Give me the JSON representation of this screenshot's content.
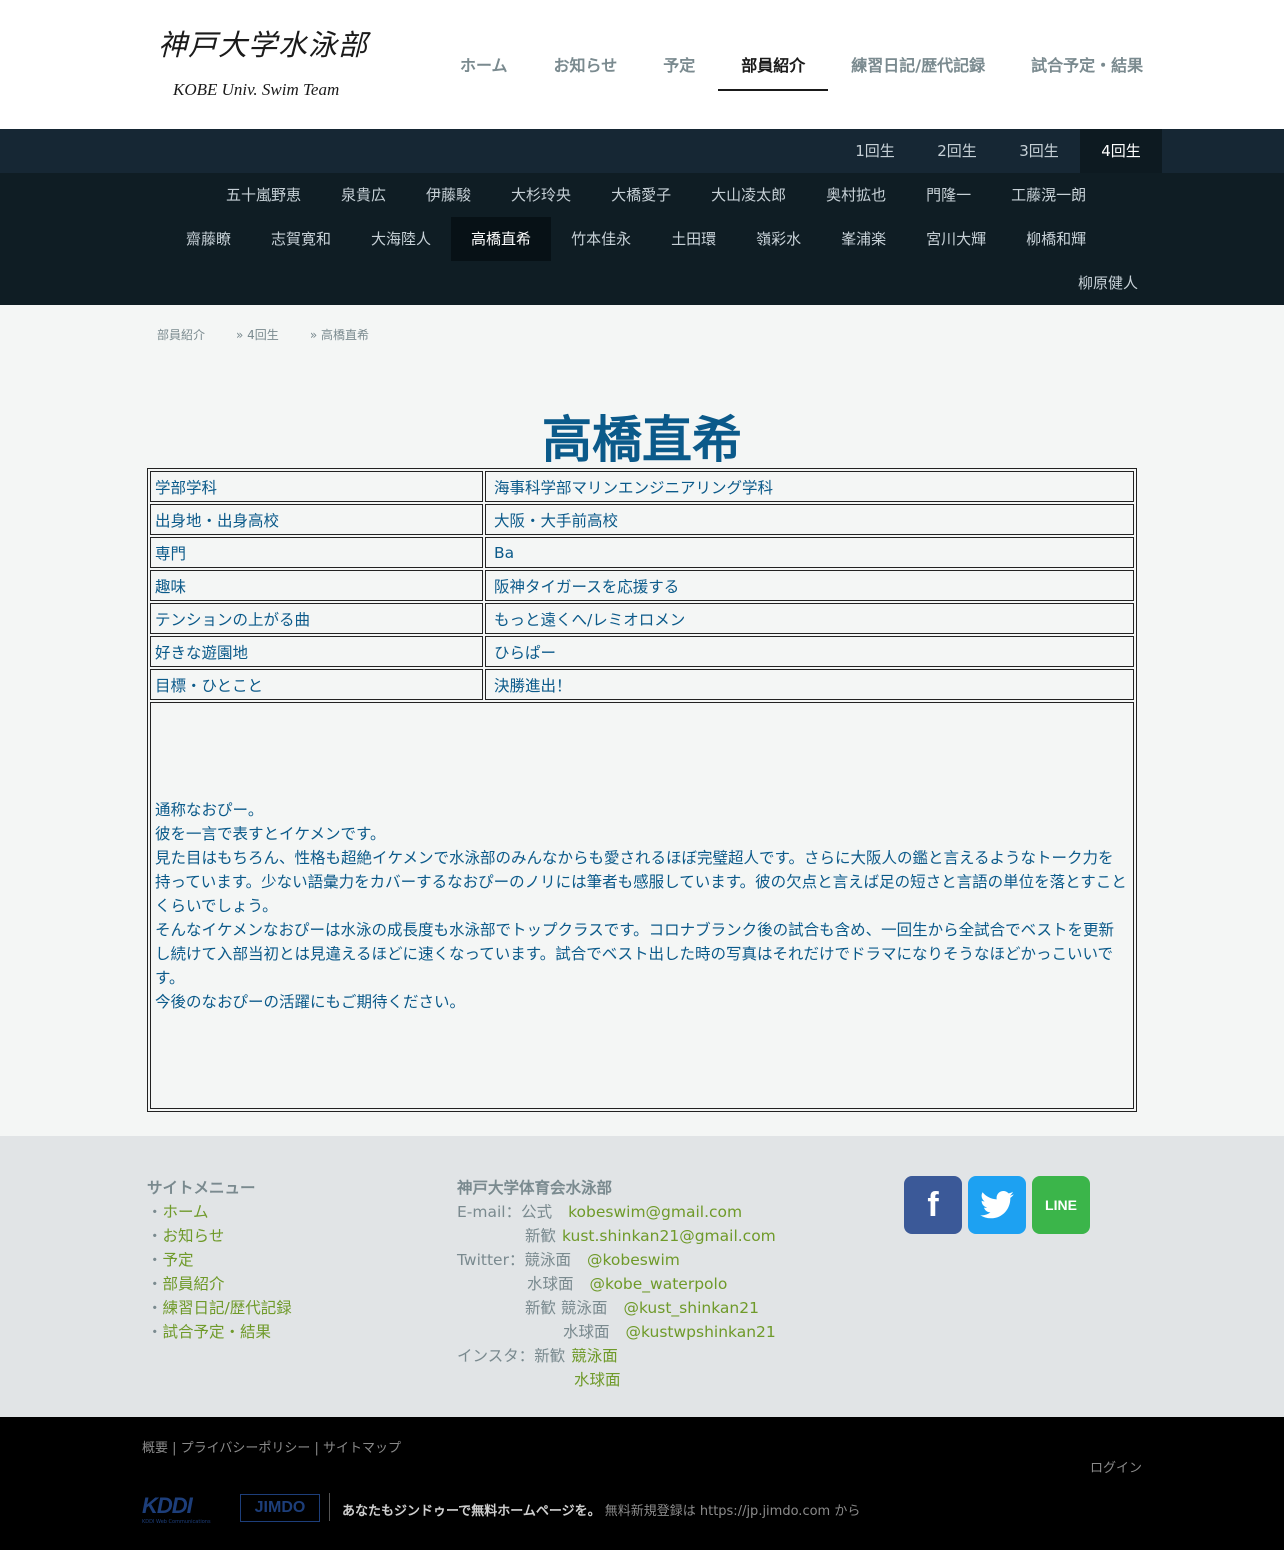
{
  "header": {
    "logo_title": "神戸大学水泳部",
    "logo_subtitle": "KOBE Univ. Swim Team",
    "nav": [
      "ホーム",
      "お知らせ",
      "予定",
      "部員紹介",
      "練習日記/歴代記録",
      "試合予定・結果"
    ],
    "nav_active": "部員紹介"
  },
  "grades": [
    "1回生",
    "2回生",
    "3回生",
    "4回生"
  ],
  "grade_active": "4回生",
  "members_row1": [
    "五十嵐野恵",
    "泉貴広",
    "伊藤駿",
    "大杉玲央",
    "大橋愛子",
    "大山凌太郎",
    "奥村拡也",
    "門隆一",
    "工藤滉一朗"
  ],
  "members_row2": [
    "齋藤瞭",
    "志賀寛和",
    "大海陸人",
    "高橋直希",
    "竹本佳永",
    "土田環",
    "嶺彩水",
    "峯浦楽",
    "宮川大輝",
    "柳橋和輝"
  ],
  "members_row3": [
    "柳原健人"
  ],
  "member_active": "高橋直希",
  "breadcrumb": [
    "部員紹介",
    "» 4回生",
    "» 高橋直希"
  ],
  "page_title": "高橋直希",
  "profile": [
    {
      "key": "学部学科",
      "value": "海事科学部マリンエンジニアリング学科"
    },
    {
      "key": "出身地・出身高校",
      "value": "大阪・大手前高校"
    },
    {
      "key": "専門",
      "value": "Ba"
    },
    {
      "key": "趣味",
      "value": "阪神タイガースを応援する"
    },
    {
      "key": "テンションの上がる曲",
      "value": "もっと遠くへ/レミオロメン"
    },
    {
      "key": "好きな遊園地",
      "value": "ひらぱー"
    },
    {
      "key": "目標・ひとこと",
      "value": "決勝進出！"
    }
  ],
  "bio": [
    "通称なおぴー。",
    "彼を一言で表すとイケメンです。",
    "見た目はもちろん、性格も超絶イケメンで水泳部のみんなからも愛されるほぼ完璧超人です。さらに大阪人の鑑と言えるようなトーク力を持っています。少ない語彙力をカバーするなおぴーのノリには筆者も感服しています。彼の欠点と言えば足の短さと言語の単位を落とすことくらいでしょう。",
    "そんなイケメンなおぴーは水泳の成長度も水泳部でトップクラスです。コロナブランク後の試合も含め、一回生から全試合でベストを更新し続けて入部当初とは見違えるほどに速くなっています。試合でベスト出した時の写真はそれだけでドラマになりそうなほどかっこいいです。",
    "今後のなおぴーの活躍にもご期待ください。"
  ],
  "footer": {
    "menu_title": "サイトメニュー",
    "menu_bullet": "・",
    "menu": [
      "ホーム",
      "お知らせ",
      "予定",
      "部員紹介",
      "練習日記/歴代記録",
      "試合予定・結果"
    ],
    "club_title": "神戸大学体育会水泳部",
    "email_label": "E-mail：公式",
    "email_official": "kobeswim@gmail.com",
    "email_new_label": "新歓",
    "email_new": "kust.shinkan21@gmail.com",
    "twitter_label": "Twitter：競泳面",
    "twitter_swim": "@kobeswim",
    "twitter_wp_label": "水球面",
    "twitter_wp": "@kobe_waterpolo",
    "twitter_new_label": "新歓 競泳面",
    "twitter_new_swim": "@kust_shinkan21",
    "twitter_new_wp_label": "水球面",
    "twitter_new_wp": "@kustwpshinkan21",
    "insta_label": "インスタ：新歓",
    "insta_swim": "競泳面",
    "insta_wp": "水球面",
    "social": [
      "facebook-icon",
      "twitter-icon",
      "line-icon"
    ],
    "line_label": "LINE",
    "fb_label": "f"
  },
  "bottom": {
    "links": "概要 | プライバシーポリシー | サイトマップ",
    "login": "ログイン",
    "kddi": "KDDI",
    "kddi_sub": "KDDI Web Communications",
    "jimdo": "JIMDO",
    "promo_bold": "あなたもジンドゥーで無料ホームページを。",
    "promo_rest": "無料新規登録は https://jp.jimdo.com から"
  }
}
